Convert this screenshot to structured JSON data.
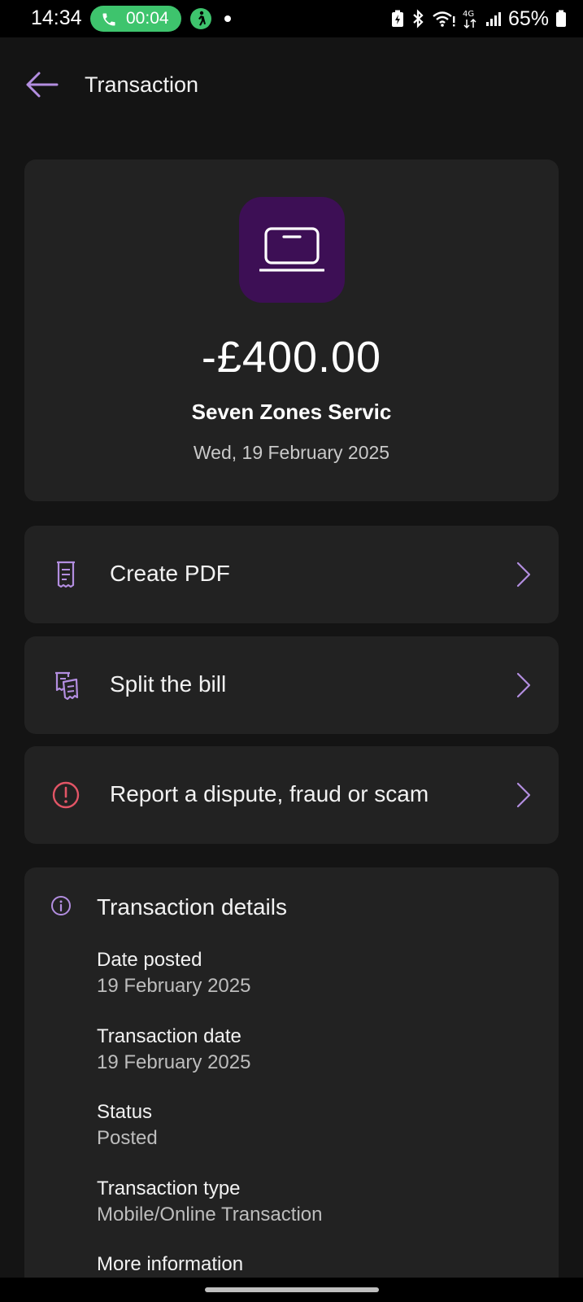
{
  "status_bar": {
    "time": "14:34",
    "call_timer": "00:04",
    "battery": "65%",
    "network": "4G",
    "call_color": "#3ec46d"
  },
  "header": {
    "title": "Transaction",
    "back_icon": "arrow-left-icon"
  },
  "summary": {
    "merchant_icon": "laptop-icon",
    "merchant_icon_bg": "#3d0f55",
    "amount": "-£400.00",
    "merchant": "Seven Zones Servic",
    "date": "Wed, 19 February 2025"
  },
  "actions": [
    {
      "label": "Create PDF",
      "icon": "receipt-icon"
    },
    {
      "label": "Split the bill",
      "icon": "split-bill-icon"
    },
    {
      "label": "Report a dispute, fraud or scam",
      "icon": "alert-circle-icon"
    }
  ],
  "details": {
    "title": "Transaction details",
    "items": [
      {
        "label": "Date posted",
        "value": "19 February 2025"
      },
      {
        "label": "Transaction date",
        "value": "19 February 2025"
      },
      {
        "label": "Status",
        "value": "Posted"
      },
      {
        "label": "Transaction type",
        "value": "Mobile/Online Transaction"
      },
      {
        "label": "More information",
        "value": ""
      }
    ]
  },
  "colors": {
    "accent": "#b38ee0",
    "alert": "#e25566",
    "background": "#141414",
    "card": "#222222"
  }
}
